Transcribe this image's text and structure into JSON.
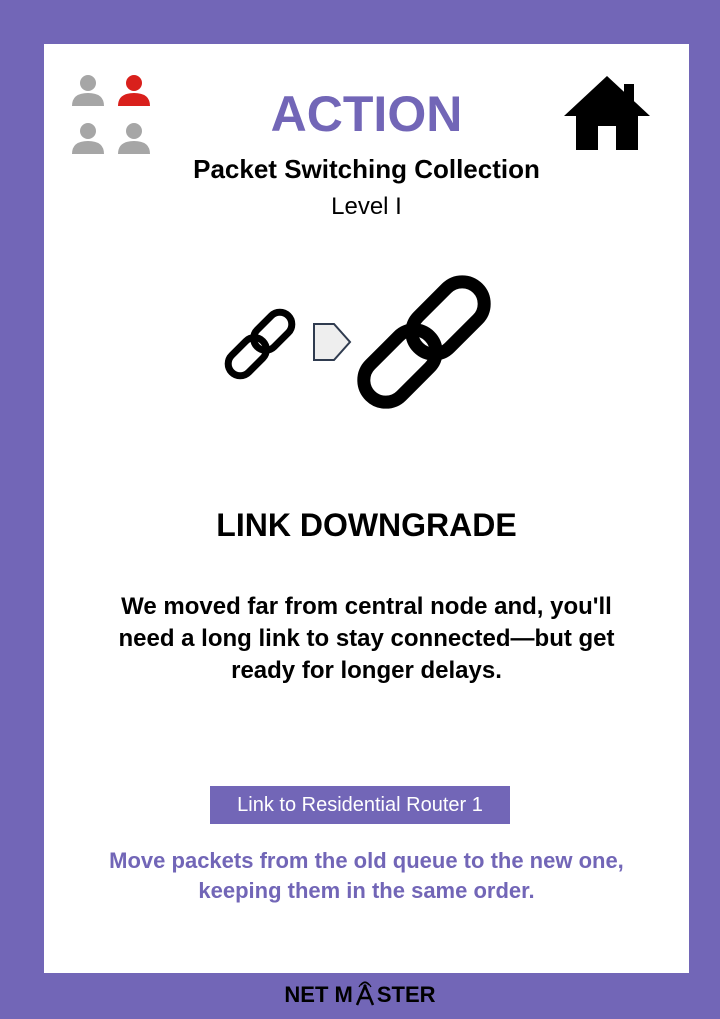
{
  "header": {
    "title": "ACTION",
    "collection": "Packet Switching Collection",
    "level": "Level I"
  },
  "players": {
    "count": 4,
    "active_index": 1,
    "icons": [
      "person-icon",
      "person-icon",
      "person-icon",
      "person-icon"
    ],
    "inactive_color": "#a6a6a6",
    "active_color": "#d9201c"
  },
  "home": {
    "icon": "home-icon"
  },
  "illustration": {
    "icons": [
      "small-link-icon",
      "arrow-right-icon",
      "large-link-icon"
    ]
  },
  "card": {
    "name": "LINK DOWNGRADE",
    "description": "We moved far from central node and, you'll need a long link to stay connected—but get ready for longer delays.",
    "link_label": "Link to Residential Router 1",
    "instruction": "Move packets from the old queue to the new one, keeping them in the same order."
  },
  "footer": {
    "brand_part1": "NET M",
    "brand_logo": "antenna-a-icon",
    "brand_part2": "STER"
  },
  "colors": {
    "brand": "#7266b7",
    "text": "#000000",
    "background": "#ffffff"
  }
}
